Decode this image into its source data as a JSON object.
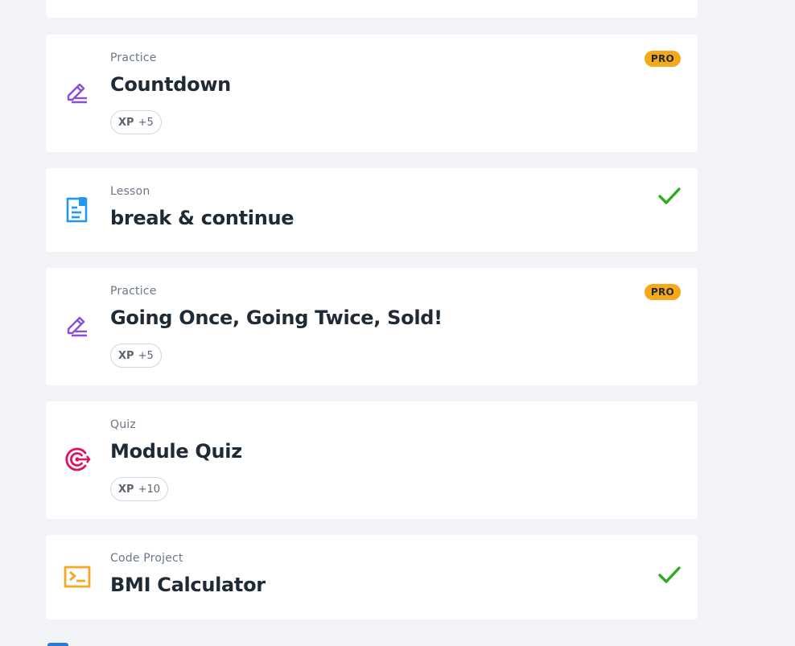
{
  "lessons": [
    {
      "type": "Practice",
      "title": "Countdown",
      "icon": "pencil-icon",
      "icon_color": "#8a4fd8",
      "xp_label": "XP",
      "xp_value": "+5",
      "badge": "PRO",
      "completed": false
    },
    {
      "type": "Lesson",
      "title": "break & continue",
      "icon": "document-icon",
      "icon_color": "#2196f3",
      "completed": true
    },
    {
      "type": "Practice",
      "title": "Going Once, Going Twice, Sold!",
      "icon": "pencil-icon",
      "icon_color": "#8a4fd8",
      "xp_label": "XP",
      "xp_value": "+5",
      "badge": "PRO",
      "completed": false
    },
    {
      "type": "Quiz",
      "title": "Module Quiz",
      "icon": "target-icon",
      "icon_color": "#e0115f",
      "xp_label": "XP",
      "xp_value": "+10",
      "completed": false
    },
    {
      "type": "Code Project",
      "title": "BMI Calculator",
      "icon": "terminal-icon",
      "icon_color": "#f5a623",
      "completed": true
    }
  ],
  "colors": {
    "background": "#f1f3f6",
    "card": "#ffffff",
    "pro_badge": "#f5a91a",
    "check": "#2eaa1e",
    "title": "#1f2a37",
    "muted": "#6b7785"
  }
}
